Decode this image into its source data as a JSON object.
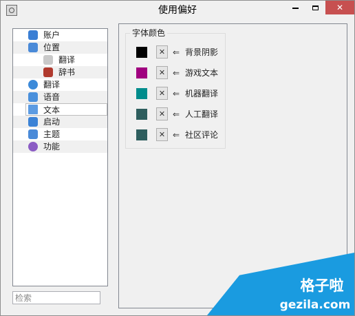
{
  "window": {
    "title": "使用偏好",
    "controls": {
      "minimize": "minimize",
      "maximize": "maximize",
      "close": "✕"
    }
  },
  "sidebar": {
    "items": [
      {
        "label": "账户",
        "icon": "user-icon",
        "color": "#3b7fd4"
      },
      {
        "label": "位置",
        "icon": "building-icon",
        "color": "#4a8ad8",
        "expanded": true
      },
      {
        "label": "翻译",
        "icon": "quill-icon",
        "color": "#c9c9c9",
        "child": true
      },
      {
        "label": "辞书",
        "icon": "book-icon",
        "color": "#b03a2e",
        "child": true
      },
      {
        "label": "翻译",
        "icon": "globe-icon",
        "color": "#3d8ad9"
      },
      {
        "label": "语音",
        "icon": "music-note-icon",
        "color": "#4a90dc"
      },
      {
        "label": "文本",
        "icon": "document-icon",
        "color": "#5c9be2",
        "selected": true
      },
      {
        "label": "启动",
        "icon": "app-store-icon",
        "color": "#3b82d6"
      },
      {
        "label": "主题",
        "icon": "window-icon",
        "color": "#4a8ad8"
      },
      {
        "label": "功能",
        "icon": "gear-icon",
        "color": "#8b5cc4"
      }
    ]
  },
  "search": {
    "placeholder": "检索"
  },
  "font_colors": {
    "title": "字体颜色",
    "clear_label": "✕",
    "arrow": "⇐",
    "rows": [
      {
        "label": "背景阴影",
        "color": "#000000"
      },
      {
        "label": "游戏文本",
        "color": "#a0007f"
      },
      {
        "label": "机器翻译",
        "color": "#008c8c"
      },
      {
        "label": "人工翻译",
        "color": "#2e5e5e"
      },
      {
        "label": "社区评论",
        "color": "#2e5e5e"
      }
    ]
  },
  "watermark": {
    "main": "格子啦",
    "sub": "gezila.com",
    "color": "#1a9be0"
  }
}
